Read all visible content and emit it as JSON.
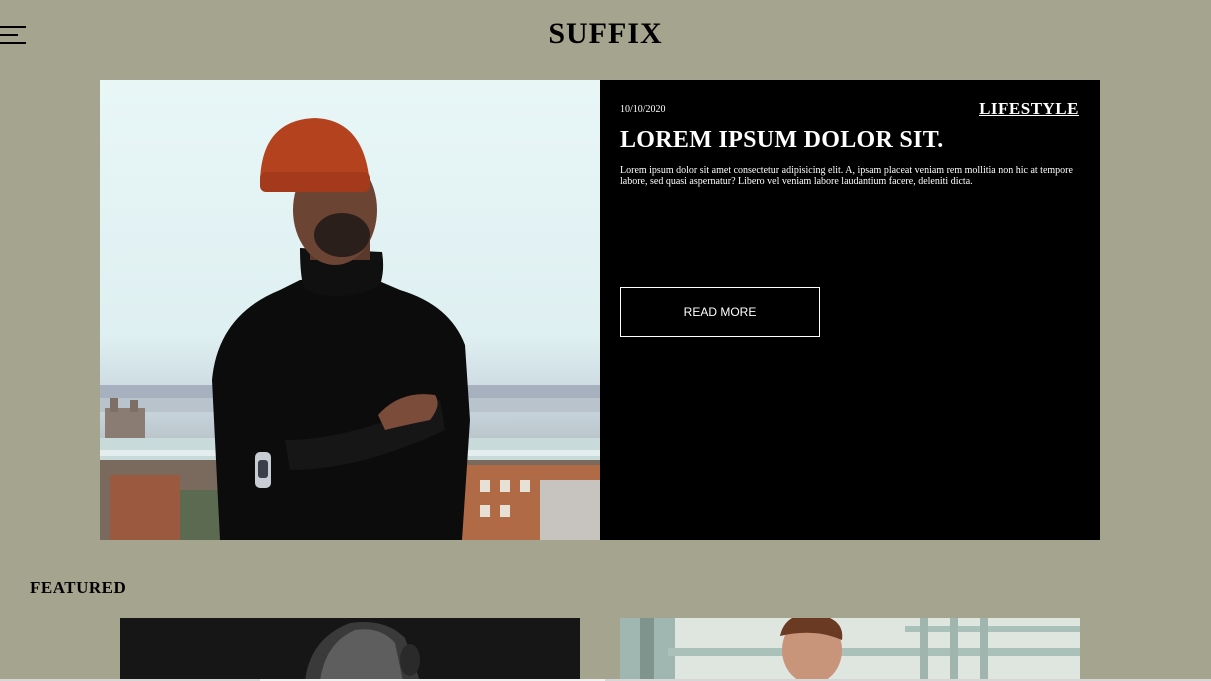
{
  "header": {
    "brand": "SUFFIX",
    "menu_icon": "hamburger-menu-icon"
  },
  "hero": {
    "date": "10/10/2020",
    "category": "LIFESTYLE",
    "title": "LOREM IPSUM DOLOR SIT.",
    "text": "Lorem ipsum dolor sit amet consectetur adipisicing elit. A, ipsam placeat veniam rem mollitia non hic at tempore labore, sed quasi aspernatur? Libero vel veniam labore laudantium facere, deleniti dicta.",
    "button_label": "READ MORE",
    "image_icon": "portrait-photo"
  },
  "featured": {
    "heading": "FEATURED",
    "cards": [
      {
        "image_icon": "portrait-photo-monochrome"
      },
      {
        "image_icon": "portrait-photo-balcony"
      }
    ]
  },
  "colors": {
    "page_background": "#a5a48f",
    "panel_background": "#000000",
    "text_light": "#ffffff",
    "text_dark": "#000000"
  }
}
